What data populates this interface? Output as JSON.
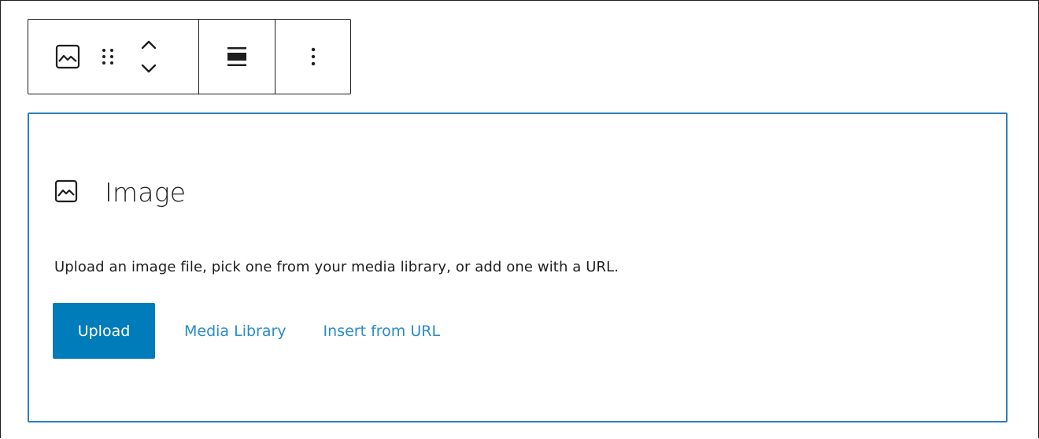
{
  "toolbar": {
    "icons": {
      "block_type": "image-icon",
      "drag": "drag-handle-icon",
      "move": "chevron-up-down-icon",
      "align": "align-wide-icon",
      "more": "more-vertical-icon"
    }
  },
  "placeholder": {
    "icon": "image-icon",
    "title": "Image",
    "instructions": "Upload an image file, pick one from your media library, or add one with a URL.",
    "actions": {
      "upload": "Upload",
      "media_library": "Media Library",
      "insert_from_url": "Insert from URL"
    }
  },
  "colors": {
    "primary": "#007cba",
    "link": "#2a8bc9",
    "focus_border": "#2a7fbd",
    "text": "#1e1e1e"
  }
}
